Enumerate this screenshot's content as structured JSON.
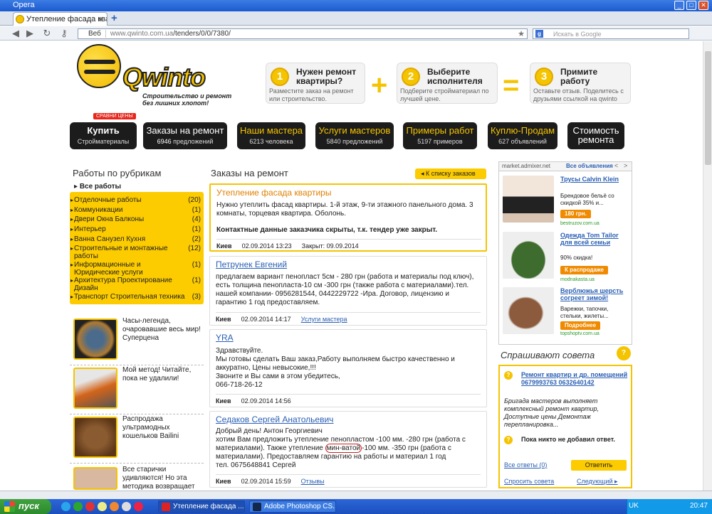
{
  "browser": {
    "app_title": "Opera",
    "tab_title": "Утепление фасада квар...",
    "url_badge": "Веб",
    "url_host": "www.qwinto.com.ua",
    "url_path": "/tenders/0/0/7380/",
    "search_placeholder": "Искать в Google"
  },
  "logo": {
    "name": "Qwinto",
    "slogan_line1": "Строительство и ремонт",
    "slogan_line2": "без лишних хлопот!"
  },
  "steps": [
    {
      "num": "1",
      "title": "Нужен ремонт квартиры?",
      "desc": "Разместите заказ на ремонт или строительство."
    },
    {
      "num": "2",
      "title": "Выберите исполнителя",
      "desc": "Подберите стройматериал по лучшей цене."
    },
    {
      "num": "3",
      "title": "Примите работу",
      "desc": "Оставьте отзыв. Поделитесь с друзьями ссылкой на qwinto"
    }
  ],
  "signs": {
    "plus": "+",
    "equals": "="
  },
  "nav": {
    "badge": "СРАВНИ ЦЕНЫ",
    "buy": {
      "label": "Купить",
      "sub": "Стройматериалы"
    },
    "items": [
      {
        "label": "Заказы на ремонт",
        "count": "6946",
        "unit": "предложений"
      },
      {
        "label": "Наши мастера",
        "count": "6213",
        "unit": "человека"
      },
      {
        "label": "Услуги мастеров",
        "count": "5840",
        "unit": "предложений"
      },
      {
        "label": "Примеры работ",
        "count": "5197",
        "unit": "примеров"
      },
      {
        "label": "Куплю-Продам",
        "count": "627",
        "unit": "объявлений"
      }
    ],
    "rating": {
      "line1": "Стоимость",
      "line2": "ремонта"
    }
  },
  "sidebar": {
    "title": "Работы по рубрикам",
    "all": "Все работы",
    "categories": [
      {
        "name": "Отделочные работы",
        "count": "(20)"
      },
      {
        "name": "Коммуникации",
        "count": "(1)"
      },
      {
        "name": "Двери Окна Балконы",
        "count": "(4)"
      },
      {
        "name": "Интерьер",
        "count": "(1)"
      },
      {
        "name": "Ванна Санузел Кухня",
        "count": "(2)"
      },
      {
        "name": "Строительные и монтажные работы",
        "count": "(12)"
      },
      {
        "name": "Информационные и Юридические услуги",
        "count": "(1)"
      },
      {
        "name": "Архитектура Проектирование Дизайн",
        "count": "(1)"
      },
      {
        "name": "Транспорт Строительная техника",
        "count": "(3)"
      }
    ],
    "ads": [
      {
        "text": "Часы-легенда, очаровавшие весь мир! Суперцена"
      },
      {
        "text": "Мой метод! Читайте, пока не удалили!"
      },
      {
        "text": "Распродажа ультрамодных кошельков Bailini"
      },
      {
        "text": "Все старички удивляются! Но эта методика возвращает"
      }
    ]
  },
  "orders": {
    "title": "Заказы на ремонт",
    "back": "К списку заказов",
    "list": [
      {
        "title": "Утепление фасада квартиры",
        "body": "Нужно утеплить фасад квартиры. 1-й этаж, 9-ти этажного панельного дома. 3 комнаты, торцевая квартира. Оболонь.",
        "note": "Контактные данные заказчика скрыты, т.к. тендер уже закрыт.",
        "city": "Киев",
        "date": "02.09.2014 13:23",
        "extra": "Закрыт: 09.09.2014"
      },
      {
        "title": "Петрунек Евгений",
        "body": "предлагаем вариант пенопласт 5см - 280 грн (работа и материалы под ключ), есть толщина пенопласта-10 см -300 грн (также работа с материалами).тел. нашей компании- 0956281544, 0442229722 -Ира. Договор, лицензию и гарантию 1 год предоставляем.",
        "city": "Киев",
        "date": "02.09.2014 14:17",
        "link": "Услуги мастера"
      },
      {
        "title": "YRA",
        "body_lines": [
          "Здравствуйте.",
          "Мы готовы сделать Ваш заказ,Работу выполняем быстро качественно и аккуратно, Цены невысокие,!!!",
          "Звоните и Вы сами в этом убедитесь,",
          "066-718-26-12"
        ],
        "city": "Киев",
        "date": "02.09.2014 14:56"
      },
      {
        "title": "Седаков Сергей Анатольевич",
        "body_a": "Добрый день! Антон Георгиевич",
        "body_b": "хотим Вам предложить утепление пенопластом -100 мм. -280 грн (работа с материалами). Также утепление",
        "body_c": "мин-ватой",
        "body_d": "-100 мм. -350 грн (работа с материалами). Предоставляем гарантию на работы и материал 1 год",
        "body_e": "тел. 0675648841 Сергей",
        "city": "Киев",
        "date": "02.09.2014 15:59",
        "link": "Отзывы"
      }
    ]
  },
  "market": {
    "source": "market.admixer.net",
    "all": "Все объявления",
    "prev": "<",
    "next": ">",
    "items": [
      {
        "title": "Трусы Calvin Klein",
        "desc": "Брендовое бельё со скидкой 35% и...",
        "price": "180 грн.",
        "src": "bestruzov.com.ua"
      },
      {
        "title": "Одежда Tom Tailor для всей семьи",
        "desc": "90% скидка!",
        "price": "К распродаже",
        "src": "modnakasta.ua"
      },
      {
        "title": "Верблюжья шерсть согреет зимой!",
        "desc": "Варежки, тапочки, стельки, жилеты...",
        "price": "Подробнее",
        "src": "topshoptv.com.ua"
      }
    ]
  },
  "ask": {
    "title": "Спрашивают совета",
    "icon": "?",
    "question": "Ремонт квартир и др. помещений 0679993763 0632640142",
    "desc": "Бригада мастеров выполняет комплексный ремонт квартир, Доступные цены Демонтаж перепланировка...",
    "no_answer": "Пока никто не добавил ответ.",
    "all_answers": "Все ответы (0)",
    "reply": "Ответить",
    "ask_btn": "Спросить совета",
    "next": "Следующий"
  },
  "taskbar": {
    "start": "пуск",
    "win1": "Утепление фасада ...",
    "win2": "Adobe Photoshop CS...",
    "lang": "UK",
    "clock": "20:47"
  }
}
